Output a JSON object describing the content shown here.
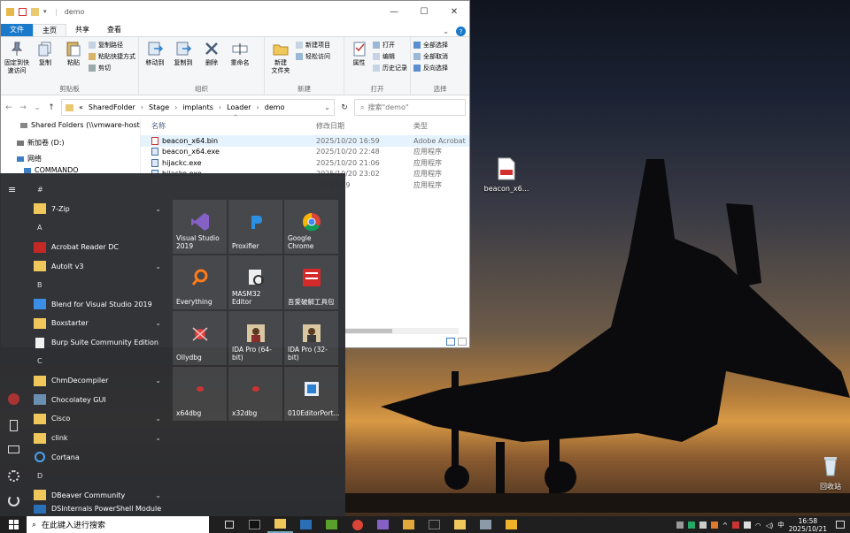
{
  "explorer": {
    "title": "demo",
    "tabs": [
      "文件",
      "主页",
      "共享",
      "查看"
    ],
    "ribbon": {
      "clipboard": {
        "label": "剪贴板",
        "pin": "固定到快\n速访问",
        "copy": "复制",
        "paste": "粘贴",
        "copy_path": "复制路径",
        "paste_shortcut": "粘贴快捷方式",
        "cut": "剪切"
      },
      "organize": {
        "label": "组织",
        "move_to": "移动到",
        "copy_to": "复制到",
        "delete": "删除",
        "rename": "重命名"
      },
      "new": {
        "label": "新建",
        "new_folder": "新建\n文件夹",
        "new_item": "新建项目",
        "easy_access": "轻松访问"
      },
      "open": {
        "label": "打开",
        "properties": "属性",
        "open": "打开",
        "edit": "编辑",
        "history": "历史记录"
      },
      "select": {
        "label": "选择",
        "select_all": "全部选择",
        "select_none": "全部取消",
        "invert": "反向选择"
      }
    },
    "address": [
      "SharedFolder",
      "Stage",
      "implants",
      "Loader",
      "demo"
    ],
    "address_prefix": "«",
    "search_placeholder": "搜索\"demo\"",
    "navpane": [
      "Shared Folders (\\\\vmware-host",
      "新加卷 (D:)",
      "网络",
      "COMMANDO"
    ],
    "columns": {
      "name": "名称",
      "date": "修改日期",
      "type": "类型"
    },
    "files": [
      {
        "name": "beacon_x64.bin",
        "date": "2025/10/20 16:59",
        "type": "Adobe Acrobat"
      },
      {
        "name": "beacon_x64.exe",
        "date": "2025/10/20 22:48",
        "type": "应用程序"
      },
      {
        "name": "hijackc.exe",
        "date": "2025/10/20 21:06",
        "type": "应用程序"
      },
      {
        "name": "hijacke.exe",
        "date": "2025/10/20 23:02",
        "type": "应用程序"
      },
      {
        "name": "",
        "date": "/22 10:19",
        "type": "应用程序"
      }
    ]
  },
  "start_menu": {
    "groups": [
      {
        "header": "#",
        "apps": [
          {
            "name": "7-Zip",
            "folder": true
          }
        ]
      },
      {
        "header": "A",
        "apps": [
          {
            "name": "Acrobat Reader DC",
            "folder": false
          },
          {
            "name": "AutoIt v3",
            "folder": true
          }
        ]
      },
      {
        "header": "B",
        "apps": [
          {
            "name": "Blend for Visual Studio 2019",
            "folder": false
          },
          {
            "name": "Boxstarter",
            "folder": true
          },
          {
            "name": "Burp Suite Community Edition",
            "folder": false
          }
        ]
      },
      {
        "header": "C",
        "apps": [
          {
            "name": "ChmDecompiler",
            "folder": true
          },
          {
            "name": "Chocolatey GUI",
            "folder": false
          },
          {
            "name": "Cisco",
            "folder": true
          },
          {
            "name": "clink",
            "folder": true
          },
          {
            "name": "Cortana",
            "folder": false
          }
        ]
      },
      {
        "header": "D",
        "apps": [
          {
            "name": "DBeaver Community",
            "folder": true
          },
          {
            "name": "DSInternals PowerShell Module",
            "folder": false
          }
        ]
      }
    ],
    "tiles": [
      "Visual Studio 2019",
      "Proxifier",
      "Google Chrome",
      "Everything",
      "MASM32 Editor",
      "吾爱破解工具包",
      "Ollydbg",
      "IDA Pro (64-bit)",
      "IDA Pro (32-bit)",
      "x64dbg",
      "x32dbg",
      "010EditorPort..."
    ]
  },
  "desktop": {
    "icons": [
      {
        "label": "beacon_x6..."
      },
      {
        "label": "回收站"
      }
    ]
  },
  "taskbar": {
    "search_placeholder": "在此键入进行搜索",
    "ime": "中",
    "time": "16:58",
    "date": "2025/10/21"
  },
  "colors": {
    "file_tab": "#1979ca",
    "start_bg": "#2b2d32",
    "taskbar": "#1f1f1f"
  }
}
